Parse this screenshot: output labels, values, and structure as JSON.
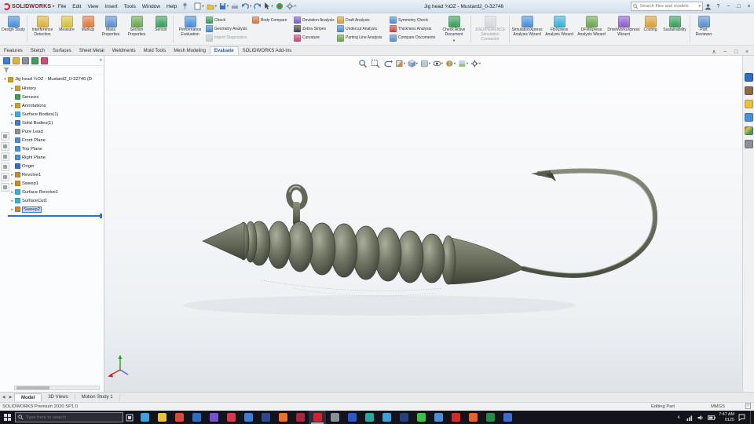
{
  "glyphs": {
    "tree_arrow": "▸",
    "root_arrow": "▾",
    "caret": "▾",
    "left": "◀",
    "right": "▶",
    "chevron": "∧",
    "min": "−",
    "max": "□",
    "close": "×",
    "help": "?",
    "more": "»",
    "flyout": "▸"
  },
  "colors": {
    "accent_blue": "#2f6fd0",
    "sw_red": "#d2232a",
    "selection": "#cfe3f7",
    "taskbar_bg": "#13131b"
  },
  "titlebar": {
    "logo_text": "SOLIDWORKS",
    "menus": [
      "File",
      "Edit",
      "View",
      "Insert",
      "Tools",
      "Window",
      "Help"
    ],
    "doc_title": "Jig head ¾OZ - Mustard2_0-32746",
    "search_placeholder": "Search files and models"
  },
  "ribbon": {
    "large_left": [
      {
        "label": "Design Study",
        "color": "#4a90d9"
      },
      {
        "label": "Interference Detection",
        "color": "#e0b23a"
      },
      {
        "label": "Measure",
        "color": "#d9c23a"
      },
      {
        "label": "Markup",
        "color": "#e07b39"
      },
      {
        "label": "Mass Properties",
        "color": "#5a8fd0"
      },
      {
        "label": "Section Properties",
        "color": "#6aa84f"
      },
      {
        "label": "Sensor",
        "color": "#3aa05a"
      },
      {
        "label": "Performance Evaluation",
        "color": "#4a90d9"
      }
    ],
    "stack1": [
      {
        "label": "Check",
        "color": "#3aa05a"
      },
      {
        "label": "Geometry Analysis",
        "color": "#4a90d9"
      },
      {
        "label": "Import Diagnostics",
        "color": "#9aa0a8"
      }
    ],
    "body_compare": {
      "label": "Body Compare",
      "color": "#e07b39"
    },
    "stack2": [
      {
        "label": "Deviation Analysis",
        "color": "#7a5fd0"
      },
      {
        "label": "Zebra Stripes",
        "color": "#44484e"
      },
      {
        "label": "Curvature",
        "color": "#d04a7a"
      }
    ],
    "stack3": [
      {
        "label": "Draft Analysis",
        "color": "#d9a23a"
      },
      {
        "label": "Undercut Analysis",
        "color": "#4a90d9"
      },
      {
        "label": "Parting Line Analysis",
        "color": "#6aa84f"
      }
    ],
    "stack4": [
      {
        "label": "Symmetry Check",
        "color": "#4a90d9"
      },
      {
        "label": "Thickness Analysis",
        "color": "#d04a4a"
      },
      {
        "label": "Compare Documents",
        "color": "#5a8fd0"
      }
    ],
    "check_active": {
      "label": "Check Active Document",
      "color": "#3aa05a"
    },
    "connector": {
      "label": "3DEXPERIENCE Simulation Connector",
      "color": "#b8bcc2"
    },
    "wizards": [
      {
        "label": "SimulationXpress Analysis Wizard",
        "color": "#4a90d9"
      },
      {
        "label": "FloXpress Analysis Wizard",
        "color": "#3ab0d9"
      },
      {
        "label": "DFMXpress Analysis Wizard",
        "color": "#6aa84f"
      },
      {
        "label": "DriveWorksXpress Wizard",
        "color": "#8a5fd0"
      },
      {
        "label": "Costing",
        "color": "#d9a23a"
      },
      {
        "label": "Sustainability",
        "color": "#3aa05a"
      }
    ],
    "part_reviewer": {
      "label": "Part Reviewer",
      "color": "#5a8fd0"
    }
  },
  "tabs": {
    "items": [
      "Features",
      "Sketch",
      "Surfaces",
      "Sheet Metal",
      "Weldments",
      "Mold Tools",
      "Mesh Modeling",
      "Evaluate",
      "SOLIDWORKS Add-Ins"
    ],
    "active": "Evaluate"
  },
  "feature_tree": {
    "header_tabs": [
      {
        "name": "featuremanager-tab",
        "color": "#3a7fd4"
      },
      {
        "name": "propertymanager-tab",
        "color": "#e0b23a"
      },
      {
        "name": "configurationmanager-tab",
        "color": "#8a8f98"
      },
      {
        "name": "dimxpertmanager-tab",
        "color": "#3aa05a"
      },
      {
        "name": "displaymanager-tab",
        "color": "#d04a7a"
      }
    ],
    "root": "Jig head ¾OZ - Mustard2_0-32746 (D",
    "items": [
      {
        "label": "History",
        "color": "#c9a227"
      },
      {
        "label": "Sensors",
        "color": "#3aa05a"
      },
      {
        "label": "Annotations",
        "color": "#c9a227"
      },
      {
        "label": "Surface Bodies(1)",
        "color": "#3ab0d9"
      },
      {
        "label": "Solid Bodies(1)",
        "color": "#4a78c4"
      },
      {
        "label": "Pure Lead",
        "color": "#8a8f98"
      },
      {
        "label": "Front Plane",
        "color": "#4a90d9"
      },
      {
        "label": "Top Plane",
        "color": "#4a90d9"
      },
      {
        "label": "Right Plane",
        "color": "#4a90d9"
      },
      {
        "label": "Origin",
        "color": "#3a6fc4"
      },
      {
        "label": "Revolve1",
        "color": "#c98a27"
      },
      {
        "label": "Sweep1",
        "color": "#c98a27"
      },
      {
        "label": "Surface-Revolve1",
        "color": "#3ab0d9"
      },
      {
        "label": "SurfaceCut1",
        "color": "#3ab0d9"
      },
      {
        "label": "Sweep2",
        "color": "#c98a27",
        "selected": true
      }
    ]
  },
  "viewport": {
    "heads_up_icons": [
      "zoom-fit",
      "zoom-area",
      "previous-view",
      "section-view",
      "view-orientation",
      "display-style",
      "hide-show-items",
      "edit-appearance",
      "apply-scene",
      "view-settings"
    ]
  },
  "bottom_tabs": {
    "items": [
      "Model",
      "3D Views",
      "Motion Study 1"
    ],
    "active": "Model"
  },
  "statusbar": {
    "left": "SOLIDWORKS Premium 2020 SP1.0",
    "mode": "Editing Part",
    "units": "MMGS"
  },
  "taskbar": {
    "search_placeholder": "Type here to search",
    "time": "7:47 AM",
    "date": "0125",
    "apps": [
      {
        "name": "edge",
        "color": "#3aa3d9"
      },
      {
        "name": "file-explorer",
        "color": "#e8c23a"
      },
      {
        "name": "chrome",
        "color": "#d94a3a"
      },
      {
        "name": "browser-blue",
        "color": "#2a6fc4"
      },
      {
        "name": "app-purple",
        "color": "#7a4fd0"
      },
      {
        "name": "opera",
        "color": "#d43a4a"
      },
      {
        "name": "app-blue",
        "color": "#3a7fd4"
      },
      {
        "name": "app-navy",
        "color": "#2a4a8a"
      },
      {
        "name": "firefox",
        "color": "#e8742a"
      },
      {
        "name": "app-dark-red",
        "color": "#a82a3a"
      },
      {
        "name": "solidworks",
        "color": "#d2232a",
        "active": true
      },
      {
        "name": "app-gray",
        "color": "#8a8f98"
      },
      {
        "name": "word",
        "color": "#2a5ac4"
      },
      {
        "name": "app-teal",
        "color": "#2aa8a0"
      },
      {
        "name": "telegram",
        "color": "#3aa0d9"
      },
      {
        "name": "app-dark-blue",
        "color": "#24427a"
      },
      {
        "name": "whatsapp",
        "color": "#3ac24a"
      },
      {
        "name": "app-blue-2",
        "color": "#4a90d9"
      },
      {
        "name": "youtube",
        "color": "#d42a2a"
      },
      {
        "name": "app-orange",
        "color": "#e8622a"
      },
      {
        "name": "excel",
        "color": "#2a8a4a"
      },
      {
        "name": "app-blue-3",
        "color": "#3a6fd0"
      }
    ]
  }
}
